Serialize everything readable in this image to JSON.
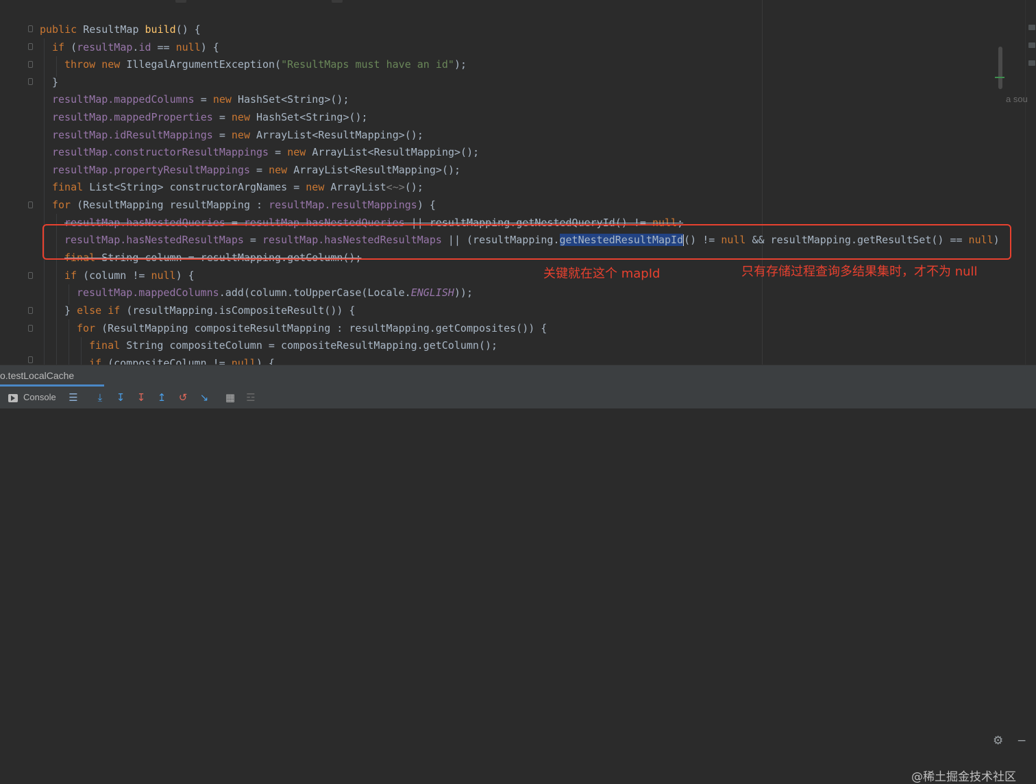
{
  "code": {
    "l1": {
      "a": "public ",
      "b": "ResultMap ",
      "c": "build",
      "d": "() {"
    },
    "l2": {
      "a": "if ",
      "b": "(",
      "c": "resultMap",
      "d": ".",
      "e": "id",
      "f": " == ",
      "g": "null",
      "h": ") {"
    },
    "l3": {
      "a": "throw ",
      "b": "new ",
      "c": "IllegalArgumentException(",
      "d": "\"ResultMaps must have an id\"",
      "e": ");"
    },
    "l4": {
      "a": "}"
    },
    "l5": {
      "a": "resultMap",
      "b": ".mappedColumns",
      "c": " = ",
      "d": "new ",
      "e": "HashSet<String>();"
    },
    "l6": {
      "a": "resultMap",
      "b": ".mappedProperties",
      "c": " = ",
      "d": "new ",
      "e": "HashSet<String>();"
    },
    "l7": {
      "a": "resultMap",
      "b": ".idResultMappings",
      "c": " = ",
      "d": "new ",
      "e": "ArrayList<ResultMapping>();"
    },
    "l8": {
      "a": "resultMap",
      "b": ".constructorResultMappings",
      "c": " = ",
      "d": "new ",
      "e": "ArrayList<ResultMapping>();"
    },
    "l9": {
      "a": "resultMap",
      "b": ".propertyResultMappings",
      "c": " = ",
      "d": "new ",
      "e": "ArrayList<ResultMapping>();"
    },
    "l10": {
      "a": "final ",
      "b": "List<String> constructorArgNames = ",
      "c": "new ",
      "d": "ArrayList",
      "e": "<~>",
      "f": "();"
    },
    "l11": {
      "a": "for ",
      "b": "(ResultMapping resultMapping : ",
      "c": "resultMap",
      "d": ".resultMappings",
      "e": ") {"
    },
    "l12": {
      "a": "resultMap",
      "b": ".hasNestedQueries",
      "c": " = ",
      "d": "resultMap",
      "e": ".hasNestedQueries",
      "f": " || resultMapping.getNestedQueryId() != ",
      "g": "null",
      "h": ";"
    },
    "l13": {
      "a": "resultMap",
      "b": ".hasNestedResultMaps",
      "c": " = ",
      "d": "resultMap",
      "e": ".hasNestedResultMaps",
      "f": " || (resultMapping.",
      "g": "getNestedResultMapId",
      "h": "() != ",
      "i": "null",
      "j": " && resultMapping.getResultSet() == ",
      "k": "null",
      "l": ")"
    },
    "l14": {
      "a": "final ",
      "b": "String column = resultMapping.getColumn();"
    },
    "l15": {
      "a": "if ",
      "b": "(column != ",
      "c": "null",
      "d": ") {"
    },
    "l16": {
      "a": "resultMap",
      "b": ".mappedColumns",
      "c": ".add(column.toUpperCase(Locale.",
      "d": "ENGLISH",
      "e": "));"
    },
    "l17": {
      "a": "} ",
      "b": "else if ",
      "c": "(resultMapping.isCompositeResult()) {"
    },
    "l18": {
      "a": "for ",
      "b": "(ResultMapping compositeResultMapping : resultMapping.getComposites()) {"
    },
    "l19": {
      "a": "final ",
      "b": "String compositeColumn = compositeResultMapping.getColumn();"
    },
    "l20": {
      "a": "if ",
      "b": "(compositeColumn != ",
      "c": "null",
      "d": ") {"
    }
  },
  "annotations": {
    "left": "关键就在这个 mapId",
    "right": "只有存储过程查询多结果集时，才不为 null"
  },
  "side_text": "a sou",
  "run_panel": {
    "tab_label": "o.testLocalCache",
    "console_label": "Console"
  },
  "watermark": "@稀土掘金技术社区",
  "colors": {
    "background": "#2b2b2b",
    "keyword": "#cc7832",
    "field": "#9876aa",
    "method": "#ffc66d",
    "string": "#6a8759",
    "annotation": "#e8412f",
    "selection": "#214283"
  }
}
